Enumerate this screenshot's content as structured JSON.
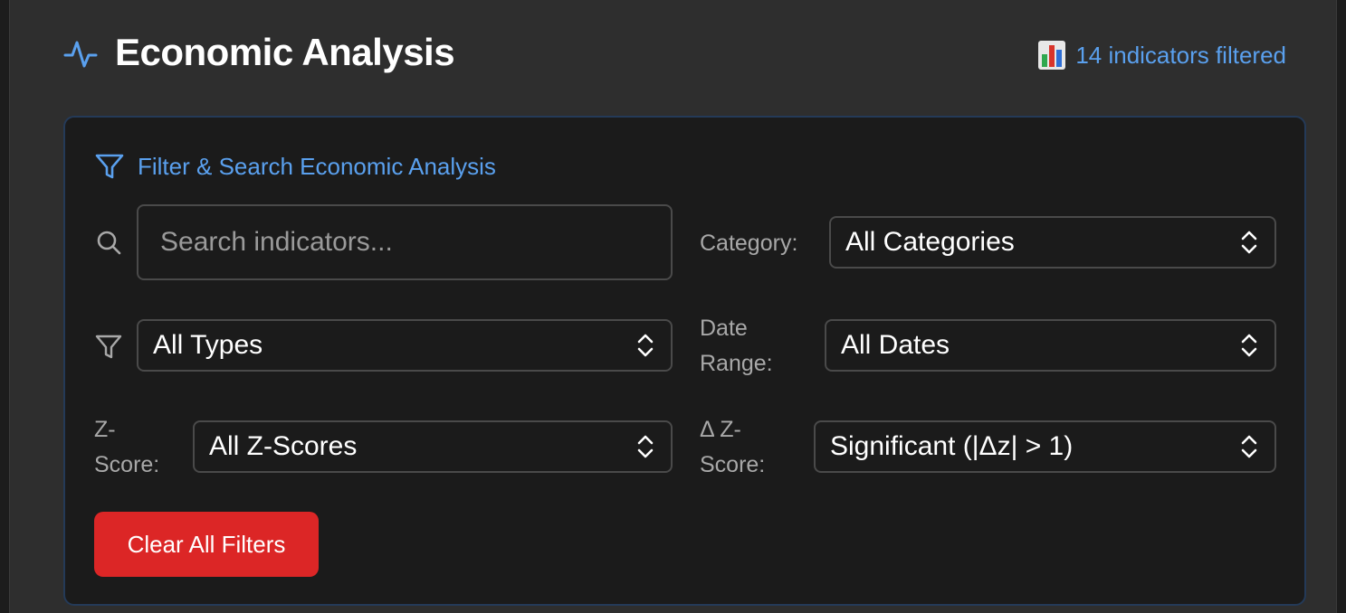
{
  "header": {
    "title": "Economic Analysis",
    "title_icon": "activity-pulse-icon",
    "count_icon": "bar-chart-icon",
    "count_label": "14 indicators filtered"
  },
  "filters": {
    "title": "Filter & Search Economic Analysis",
    "title_icon": "filter-icon",
    "search": {
      "placeholder": "Search indicators...",
      "value": ""
    },
    "category": {
      "label": "Category:",
      "value": "All Categories"
    },
    "type": {
      "icon": "filter-icon",
      "value": "All Types"
    },
    "date_range": {
      "label_line1": "Date",
      "label_line2": "Range:",
      "value": "All Dates"
    },
    "z_score": {
      "label_line1": "Z-",
      "label_line2": "Score:",
      "value": "All Z-Scores"
    },
    "delta_z_score": {
      "label_line1": "Δ Z-",
      "label_line2": "Score:",
      "value": "Significant (|Δz| > 1)"
    },
    "clear_label": "Clear All Filters"
  },
  "colors": {
    "accent": "#5aa0ee",
    "danger": "#dc2626",
    "panel": "#2e2e2e",
    "card": "#1b1b1b"
  }
}
